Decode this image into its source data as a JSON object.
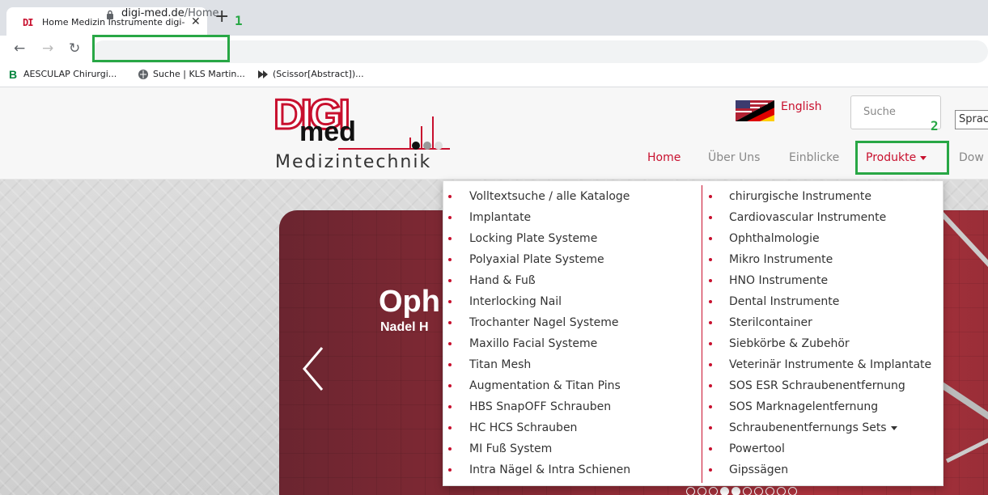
{
  "browser": {
    "tab_title": "Home Medizin Instrumente digi-med",
    "url_host": "digi-med.de",
    "url_path": "/Home",
    "bookmarks": [
      {
        "label": "AESCULAP Chirurgi...",
        "icon": "aesculap-b-icon"
      },
      {
        "label": "Suche | KLS Martin...",
        "icon": "globe-icon"
      },
      {
        "label": "(Scissor[Abstract])...",
        "icon": "scissor-icon"
      }
    ]
  },
  "annotations": {
    "one": "1",
    "two": "2"
  },
  "colors": {
    "brand_red": "#c8102e",
    "annotation_green": "#28a745"
  },
  "header": {
    "logo_tagline": "Medizintechnik",
    "logo_text_1": "DIGI",
    "logo_text_2": "med",
    "language_label": "English",
    "search_placeholder": "Suche",
    "lang_select_value": "Sprac",
    "nav": [
      {
        "label": "Home",
        "active": true
      },
      {
        "label": "Über Uns",
        "active": false
      },
      {
        "label": "Einblicke",
        "active": false
      },
      {
        "label": "Produkte",
        "active": false
      },
      {
        "label": "Dow",
        "active": false
      }
    ]
  },
  "hero": {
    "title": "Oph",
    "subtitle": "Nadel H",
    "dots_total": 10,
    "dots_active": [
      3,
      4
    ]
  },
  "dropdown": {
    "left": [
      "Volltextsuche / alle Kataloge",
      "Implantate",
      "Locking Plate Systeme",
      "Polyaxial Plate Systeme",
      "Hand & Fuß",
      "Interlocking Nail",
      "Trochanter Nagel Systeme",
      "Maxillo Facial Systeme",
      "Titan Mesh",
      "Augmentation & Titan Pins",
      "HBS SnapOFF Schrauben",
      "HC HCS Schrauben",
      "MI Fuß System",
      "Intra Nägel & Intra Schienen"
    ],
    "right": [
      "chirurgische Instrumente",
      "Cardiovascular Instrumente",
      "Ophthalmologie",
      "Mikro Instrumente",
      "HNO Instrumente",
      "Dental Instrumente",
      "Sterilcontainer",
      "Siebkörbe & Zubehör",
      "Veterinär Instrumente & Implantate",
      "SOS ESR Schraubenentfernung",
      "SOS Marknagelentfernung",
      "Schraubenentfernungs Sets",
      "Powertool",
      "Gipssägen"
    ]
  }
}
